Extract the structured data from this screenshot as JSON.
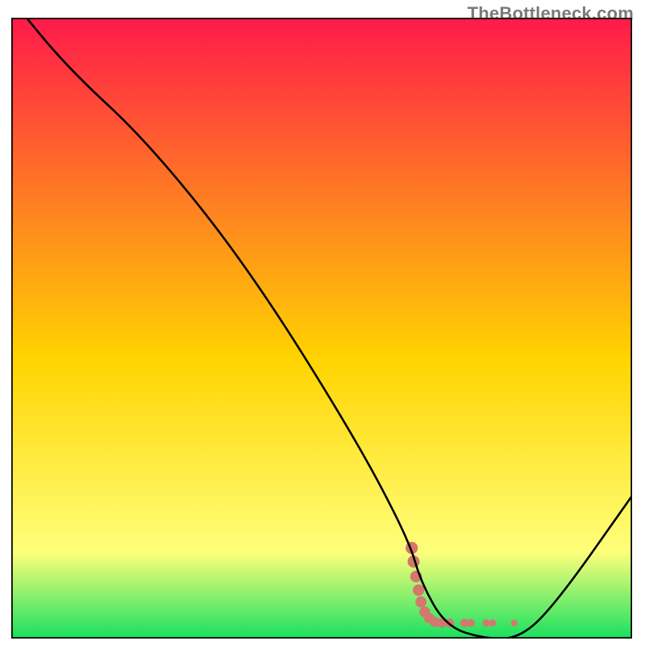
{
  "watermark": "TheBottleneck.com",
  "chart_data": {
    "type": "line",
    "title": "",
    "xlabel": "",
    "ylabel": "",
    "xlim": [
      0,
      100
    ],
    "ylim": [
      0,
      100
    ],
    "grid": false,
    "legend": false,
    "series": [
      {
        "name": "bottleneck-curve",
        "x": [
          0,
          9,
          22,
          38,
          55,
          64,
          66,
          70,
          76,
          82,
          88,
          100
        ],
        "y": [
          103,
          92,
          80,
          60,
          33,
          16,
          9,
          2,
          0,
          0,
          6,
          23
        ],
        "color": "#000000"
      }
    ],
    "markers": {
      "name": "recommended-band",
      "color": "#d4776e",
      "points": [
        {
          "x": 64.5,
          "y": 14.6
        },
        {
          "x": 64.8,
          "y": 12.4
        },
        {
          "x": 65.2,
          "y": 10.0
        },
        {
          "x": 65.6,
          "y": 7.8
        },
        {
          "x": 66.0,
          "y": 5.9
        },
        {
          "x": 66.6,
          "y": 4.3
        },
        {
          "x": 67.3,
          "y": 3.3
        },
        {
          "x": 68.2,
          "y": 2.7
        },
        {
          "x": 69.3,
          "y": 2.5
        },
        {
          "x": 70.6,
          "y": 2.5
        },
        {
          "x": 73.0,
          "y": 2.5
        },
        {
          "x": 74.0,
          "y": 2.5
        },
        {
          "x": 76.5,
          "y": 2.5
        },
        {
          "x": 77.5,
          "y": 2.5
        },
        {
          "x": 81.0,
          "y": 2.5
        }
      ],
      "radii": [
        7.6,
        7.5,
        7.3,
        7.1,
        6.9,
        6.7,
        6.5,
        6.2,
        5.9,
        5.6,
        5.2,
        5.0,
        4.6,
        4.5,
        4.0
      ]
    },
    "background_gradient": {
      "top": "#ff1a4a",
      "mid": "#ffd400",
      "low": "#ffff7a",
      "bottom": "#18e060"
    }
  }
}
